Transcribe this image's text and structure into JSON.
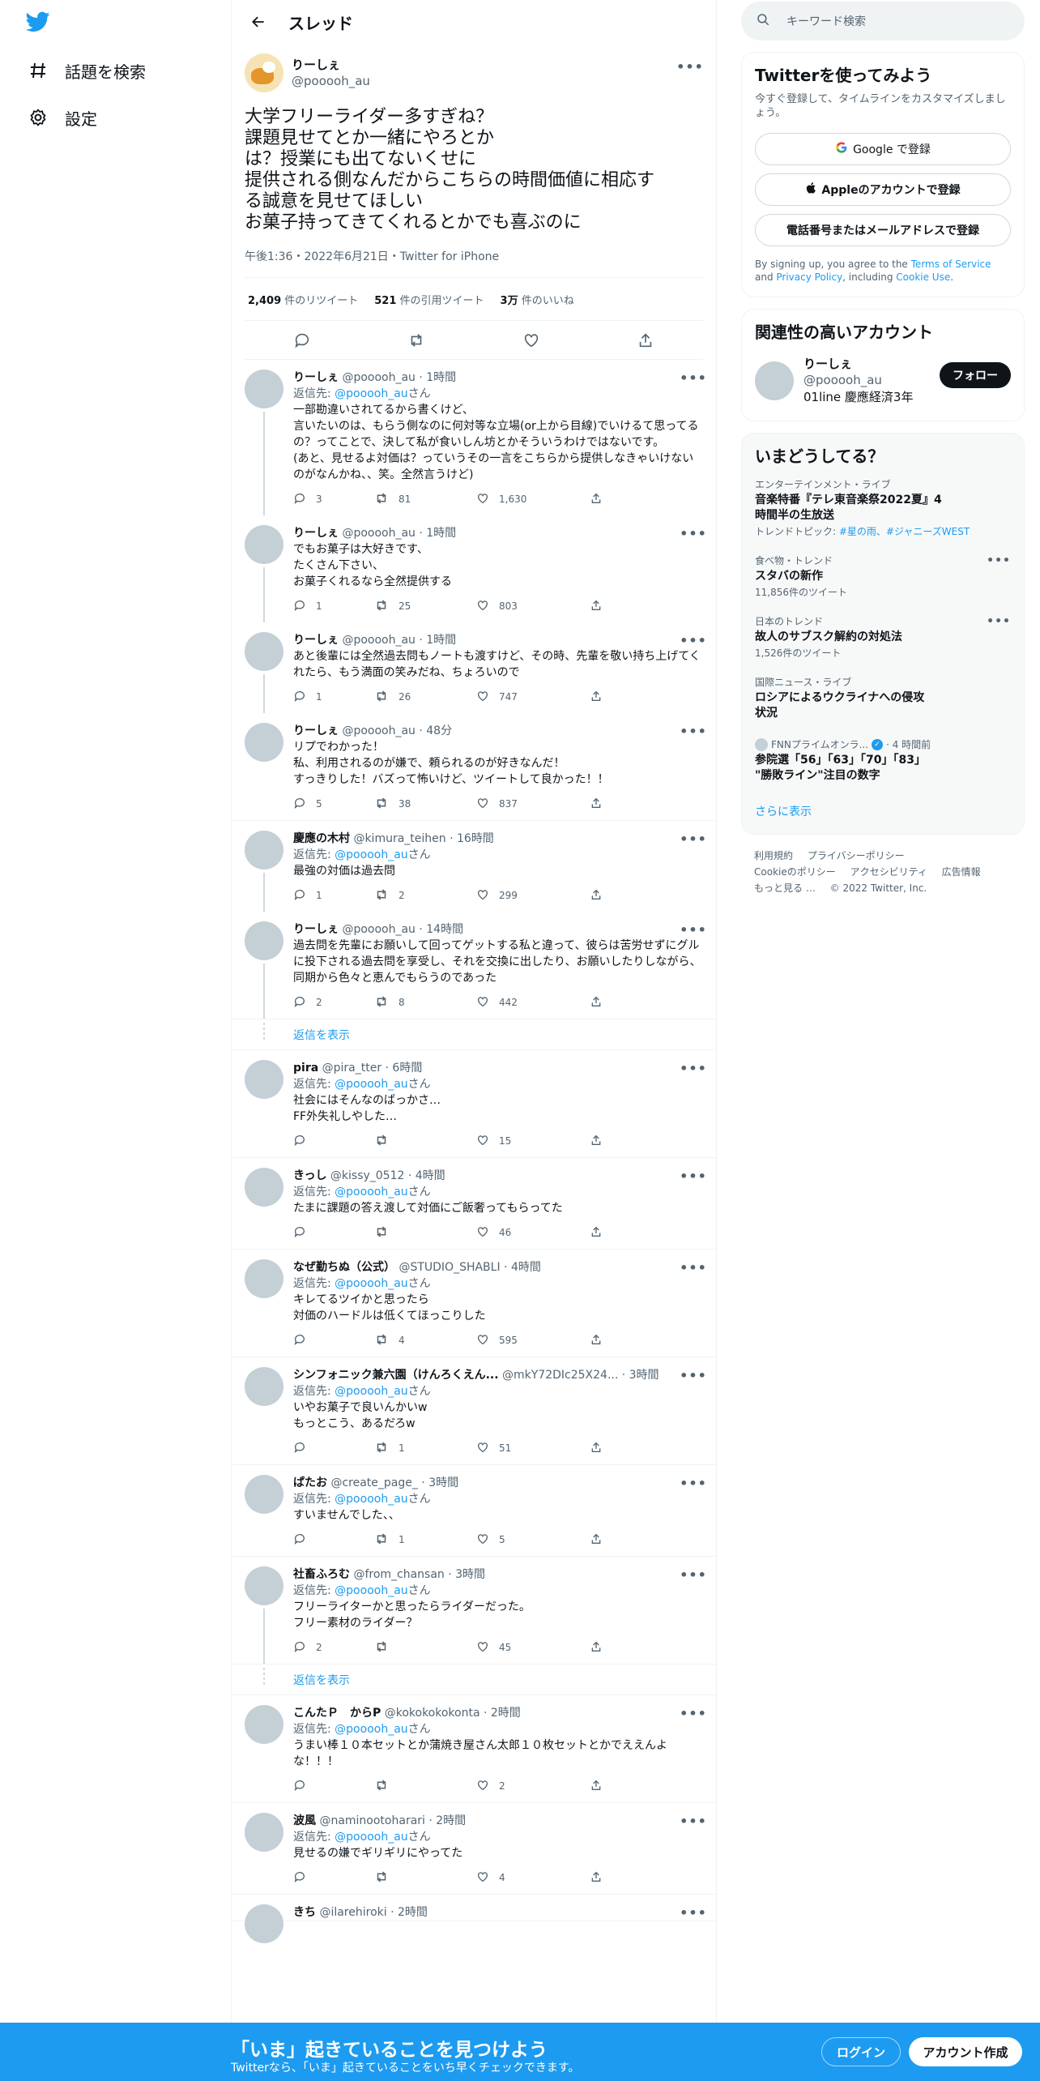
{
  "nav": {
    "explore_label": "話題を検索",
    "settings_label": "設定"
  },
  "header": {
    "title": "スレッド"
  },
  "focal": {
    "name": "りーしぇ",
    "handle": "@pooooh_au",
    "text": "大学フリーライダー多すぎね？\n課題見せてとか一緒にやろとか\nは？授業にも出てないくせに\n提供される側なんだからこちらの時間価値に相応す\nる誠意を見せてほしい\nお菓子持ってきてくれるとかでも喜ぶのに",
    "meta": "午後1:36・2022年6月21日・Twitter for iPhone",
    "retweets_num": "2,409",
    "retweets_label": " 件のリツイート",
    "quotes_num": "521",
    "quotes_label": " 件の引用ツイート",
    "likes_num": "3万",
    "likes_label": " 件のいいね"
  },
  "reply_to_prefix": "返信先: ",
  "reply_to_suffix": "さん",
  "replies": [
    {
      "name": "りーしぇ",
      "handle": "@pooooh_au · 1時間",
      "reply_to": "@pooooh_au",
      "text": "一部勘違いされてるから書くけど、\n言いたいのは、もらう側なのに何対等な立場(or上から目線)でいけるて思ってるの？ってことで、決して私が食いしん坊とかそういうわけではないです。\n(あと、見せるよ対価は？っていうその一言をこちらから提供しなきゃいけないのがなんかね、、笑。全然言うけど)",
      "replies": "3",
      "retweets": "81",
      "likes": "1,630"
    },
    {
      "name": "りーしぇ",
      "handle": "@pooooh_au · 1時間",
      "reply_to": "",
      "text": "でもお菓子は大好きです、\nたくさん下さい、\nお菓子くれるなら全然提供する",
      "replies": "1",
      "retweets": "25",
      "likes": "803"
    },
    {
      "name": "りーしぇ",
      "handle": "@pooooh_au · 1時間",
      "reply_to": "",
      "text": "あと後輩には全然過去問もノートも渡すけど、その時、先輩を敬い持ち上げてくれたら、もう満面の笑みだね、ちょろいので",
      "replies": "1",
      "retweets": "26",
      "likes": "747"
    },
    {
      "name": "りーしぇ",
      "handle": "@pooooh_au · 48分",
      "reply_to": "",
      "text": "リプでわかった！\n私、利用されるのが嫌で、頼られるのが好きなんだ！\nすっきりした！バズって怖いけど、ツイートして良かった！！",
      "replies": "5",
      "retweets": "38",
      "likes": "837"
    },
    {
      "name": "慶應の木村",
      "handle": "@kimura_teihen · 16時間",
      "reply_to": "@pooooh_au",
      "text": "最強の対価は過去問",
      "replies": "1",
      "retweets": "2",
      "likes": "299"
    },
    {
      "name": "りーしぇ",
      "handle": "@pooooh_au · 14時間",
      "reply_to": "",
      "text": "過去問を先輩にお願いして回ってゲットする私と違って、彼らは苦労せずにグルに投下される過去問を享受し、それを交換に出したり、お願いしたりしながら、同期から色々と恵んでもらうのであった",
      "replies": "2",
      "retweets": "8",
      "likes": "442"
    },
    {
      "name": "pira",
      "handle": "@pira_tter · 6時間",
      "reply_to": "@pooooh_au",
      "text": "社会にはそんなのばっかさ…\nFF外失礼しやした…",
      "replies": "",
      "retweets": "",
      "likes": "15"
    },
    {
      "name": "きっし",
      "handle": "@kissy_0512 · 4時間",
      "reply_to": "@pooooh_au",
      "text": "たまに課題の答え渡して対価にご飯奢ってもらってた",
      "replies": "",
      "retweets": "",
      "likes": "46"
    },
    {
      "name": "なぜ勤ちぬ（公式）",
      "handle": "@STUDIO_SHABLI · 4時間",
      "reply_to": "@pooooh_au",
      "text": "キレてるツイかと思ったら\n対価のハードルは低くてほっこりした",
      "replies": "",
      "retweets": "4",
      "likes": "595"
    },
    {
      "name": "シンフォニック兼六園（けんろくえん...",
      "handle": "@mkY72DIc25X24... · 3時間",
      "reply_to": "@pooooh_au",
      "text": "いやお菓子で良いんかいw\nもっとこう、あるだろw",
      "replies": "",
      "retweets": "1",
      "likes": "51"
    },
    {
      "name": "ぱたお",
      "handle": "@create_page_ · 3時間",
      "reply_to": "@pooooh_au",
      "text": "すいませんでした、、",
      "replies": "",
      "retweets": "1",
      "likes": "5"
    },
    {
      "name": "社畜ふろむ",
      "handle": "@from_chansan · 3時間",
      "reply_to": "@pooooh_au",
      "text": "フリーライターかと思ったらライダーだった。\nフリー素材のライダー？",
      "replies": "2",
      "retweets": "",
      "likes": "45"
    },
    {
      "name": "こんたＰ　からP",
      "handle": "@kokokokokonta · 2時間",
      "reply_to": "@pooooh_au",
      "text": "うまい棒１０本セットとか蒲焼き屋さん太郎１０枚セットとかでええんよな！！！",
      "replies": "",
      "retweets": "",
      "likes": "2"
    },
    {
      "name": "波風",
      "handle": "@naminootoharari · 2時間",
      "reply_to": "@pooooh_au",
      "text": "見せるの嫌でギリギリにやってた",
      "replies": "",
      "retweets": "",
      "likes": "4"
    },
    {
      "name": "きち",
      "handle": "@ilarehiroki · 2時間",
      "reply_to": "",
      "text": "",
      "replies": "",
      "retweets": "",
      "likes": ""
    }
  ],
  "show_replies_label": "返信を表示",
  "search": {
    "placeholder": "キーワード検索"
  },
  "signup": {
    "title": "Twitterを使ってみよう",
    "sub": "今すぐ登録して、タイムラインをカスタマイズしましょう。",
    "google": "Google で登録",
    "apple": "Appleのアカウントで登録",
    "phone": "電話番号またはメールアドレスで登録",
    "terms_pre": "By signing up, you agree to the ",
    "terms_link": "Terms of Service",
    "terms_mid": " and ",
    "privacy_link": "Privacy Policy",
    "terms_mid2": ", including ",
    "cookie_link": "Cookie Use",
    "terms_end": "."
  },
  "related": {
    "title": "関連性の高いアカウント",
    "name": "りーしぇ",
    "handle": "@pooooh_au",
    "bio": "01line 慶應経済3年",
    "follow": "フォロー"
  },
  "trends": {
    "title": "いまどうしてる？",
    "items": [
      {
        "meta": "エンターテインメント・ライブ",
        "title": "音楽特番『テレ東音楽祭2022夏』4\n時間半の生放送",
        "sub_pre": "トレンドトピック: ",
        "sub_link": "#星の雨、#ジャニーズWEST"
      },
      {
        "meta": "食べ物・トレンド",
        "title": "スタバの新作",
        "sub": "11,856件のツイート"
      },
      {
        "meta": "日本のトレンド",
        "title": "故人のサブスク解約の対処法",
        "sub": "1,526件のツイート"
      },
      {
        "meta": "国際ニュース・ライブ",
        "title": "ロシアによるウクライナへの侵攻\n状況"
      },
      {
        "source": "FNNプライムオンラ...",
        "time": "· 4 時間前",
        "title": "参院選「56」「63」「70」「83」\n\"勝敗ライン\"注目の数字"
      }
    ],
    "more": "さらに表示"
  },
  "footer": {
    "terms": "利用規約",
    "privacy": "プライバシーポリシー",
    "cookie": "Cookieのポリシー",
    "accessibility": "アクセシビリティ",
    "ads": "広告情報",
    "more": "もっと見る …",
    "copyright": "© 2022 Twitter, Inc."
  },
  "bottom": {
    "title": "「いま」起きていることを見つけよう",
    "sub": "Twitterなら、「いま」起きていることをいち早くチェックできます。",
    "login": "ログイン",
    "signup": "アカウント作成"
  },
  "colors": {
    "accent": "#1d9bf0",
    "text": "#0f1419",
    "muted": "#536471"
  }
}
